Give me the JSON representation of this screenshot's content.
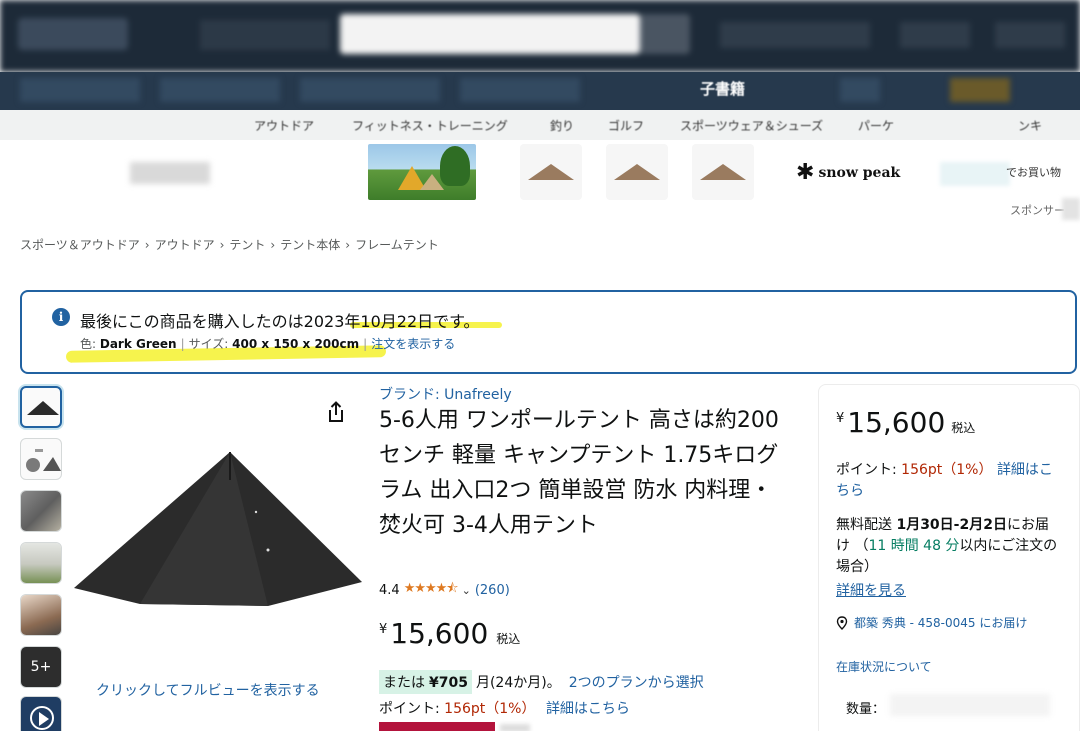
{
  "header": {
    "center_label": "子書籍"
  },
  "category_nav": {
    "items": [
      "アウトドア",
      "フィットネス・トレーニング",
      "釣り",
      "ゴルフ",
      "スポーツウェア＆シューズ",
      "パーケ",
      "ンキ"
    ]
  },
  "promo": {
    "brand_logo_text": "snow peak",
    "shop_text": "でお買い物",
    "sponsor": "スポンサー"
  },
  "breadcrumb": [
    "スポーツ＆アウトドア",
    "アウトドア",
    "テント",
    "テント本体",
    "フレームテント"
  ],
  "purchase_alert": {
    "message": "最後にこの商品を購入したのは2023年10月22日です。",
    "color_label": "色:",
    "color_value": "Dark Green",
    "size_label": "サイズ:",
    "size_value": "400 x 150 x 200cm",
    "view_order_link": "注文を表示する"
  },
  "gallery": {
    "more_count": "5+",
    "full_view_link": "クリックしてフルビューを表示する"
  },
  "product": {
    "brand_link": "ブランド: Unafreely",
    "title": "5-6人用 ワンポールテント 高さは約200センチ 軽量 キャンプテント 1.75キログラム 出入口2つ 簡単設営 防水 内料理・焚火可 3-4人用テント",
    "rating_value": "4.4",
    "rating_stars": 4.4,
    "rating_count": "(260)",
    "price_symbol": "¥",
    "price_value": "15,600",
    "price_tax": "税込",
    "installment_prefix": "または",
    "installment_amount": "¥705",
    "installment_suffix": "月(24か月)。",
    "installment_link": "2つのプランから選択",
    "points_label": "ポイント:",
    "points_value": "156pt（1%）",
    "points_link": "詳細はこちら"
  },
  "buybox": {
    "price_symbol": "¥",
    "price_value": "15,600",
    "price_tax": "税込",
    "points_label": "ポイント:",
    "points_value": "156pt（1%）",
    "points_link": "詳細はこちら",
    "shipping_prefix": "無料配送",
    "shipping_dates": "1月30日-2月2日",
    "shipping_suffix": "にお届け",
    "countdown_open": "（",
    "countdown": "11 時間 48 分",
    "countdown_suffix": "以内にご注文の場合）",
    "details_link": "詳細を見る",
    "location": "都築 秀典 - 458-0045 にお届け",
    "stock_link": "在庫状況について",
    "qty_label": "数量："
  },
  "colors": {
    "link": "#2162a1",
    "price_red": "#b12704",
    "star": "#de7921",
    "highlight": "#f5f23a",
    "alert_border": "#2162a1"
  }
}
